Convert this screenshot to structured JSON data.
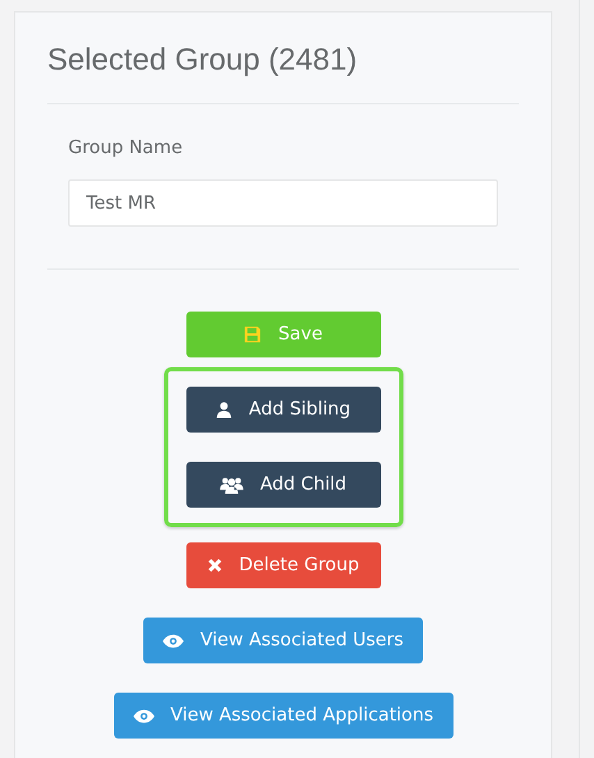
{
  "panel": {
    "title": "Selected Group (2481)"
  },
  "form": {
    "label": "Group Name",
    "value": "Test MR"
  },
  "sections": [
    {
      "highlighted": false,
      "buttons": [
        {
          "kind": "save",
          "label": "Save"
        }
      ]
    },
    {
      "highlighted": true,
      "buttons": [
        {
          "kind": "sibling",
          "label": "Add Sibling"
        },
        {
          "kind": "child",
          "label": "Add Child"
        }
      ]
    },
    {
      "highlighted": false,
      "buttons": [
        {
          "kind": "delete",
          "label": "Delete Group"
        },
        {
          "kind": "view",
          "label": "View Associated Users"
        },
        {
          "kind": "view",
          "label": "View Associated Applications"
        }
      ]
    }
  ]
}
